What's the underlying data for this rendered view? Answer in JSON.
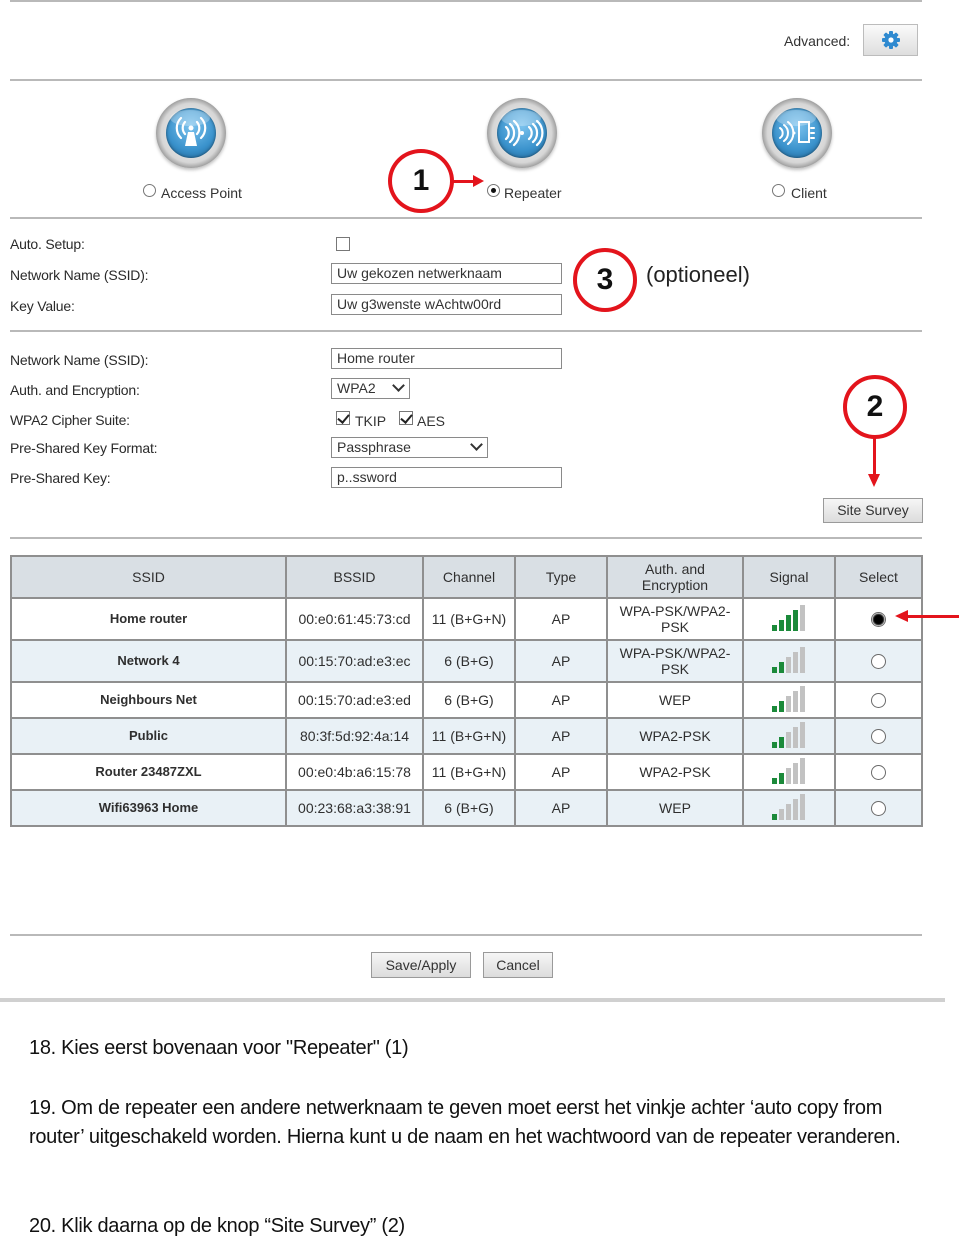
{
  "header": {
    "advanced_label": "Advanced:",
    "advanced_icon": "gear-icon",
    "accent_color": "#2f8ad0"
  },
  "modes": [
    {
      "label": "Access Point",
      "icon": "access-point-antenna-icon",
      "selected": false
    },
    {
      "label": "Repeater",
      "icon": "repeater-waves-icon",
      "selected": true
    },
    {
      "label": "Client",
      "icon": "client-device-icon",
      "selected": false
    }
  ],
  "annotations": {
    "callout_1": "1",
    "callout_2": "2",
    "callout_3": "3",
    "optional_note": "(optioneel)",
    "callout_color": "#e3141c"
  },
  "repeater_settings": {
    "auto_setup_label": "Auto. Setup:",
    "auto_setup_checked": false,
    "ssid_label": "Network Name (SSID):",
    "ssid_value": "Uw gekozen netwerknaam",
    "key_label": "Key Value:",
    "key_value": "Uw g3wenste wAchtw00rd"
  },
  "router_settings": {
    "ssid_label": "Network Name (SSID):",
    "ssid_value": "Home router",
    "auth_label": "Auth. and Encryption:",
    "auth_value": "WPA2",
    "cipher_label": "WPA2 Cipher Suite:",
    "cipher_tkip_label": "TKIP",
    "cipher_tkip_checked": true,
    "cipher_aes_label": "AES",
    "cipher_aes_checked": true,
    "psk_format_label": "Pre-Shared Key Format:",
    "psk_format_value": "Passphrase",
    "psk_label": "Pre-Shared Key:",
    "psk_value": "p..ssword",
    "site_survey_label": "Site Survey"
  },
  "survey_table": {
    "headers": [
      "SSID",
      "BSSID",
      "Channel",
      "Type",
      "Auth. and Encryption",
      "Signal",
      "Select"
    ],
    "signal_max_bars": 5,
    "rows": [
      {
        "ssid": "Home router",
        "bssid": "00:e0:61:45:73:cd",
        "channel": "11 (B+G+N)",
        "type": "AP",
        "auth": "WPA-PSK/WPA2-PSK",
        "signal_bars": 4,
        "selected": true
      },
      {
        "ssid": "Network 4",
        "bssid": "00:15:70:ad:e3:ec",
        "channel": "6 (B+G)",
        "type": "AP",
        "auth": "WPA-PSK/WPA2-PSK",
        "signal_bars": 2,
        "selected": false
      },
      {
        "ssid": "Neighbours Net",
        "bssid": "00:15:70:ad:e3:ed",
        "channel": "6 (B+G)",
        "type": "AP",
        "auth": "WEP",
        "signal_bars": 2,
        "selected": false
      },
      {
        "ssid": "Public",
        "bssid": "80:3f:5d:92:4a:14",
        "channel": "11 (B+G+N)",
        "type": "AP",
        "auth": "WPA2-PSK",
        "signal_bars": 2,
        "selected": false
      },
      {
        "ssid": "Router 23487ZXL",
        "bssid": "00:e0:4b:a6:15:78",
        "channel": "11 (B+G+N)",
        "type": "AP",
        "auth": "WPA2-PSK",
        "signal_bars": 2,
        "selected": false
      },
      {
        "ssid": "Wifi63963 Home",
        "bssid": "00:23:68:a3:38:91",
        "channel": "6 (B+G)",
        "type": "AP",
        "auth": "WEP",
        "signal_bars": 1,
        "selected": false
      }
    ]
  },
  "footer_buttons": {
    "save_label": "Save/Apply",
    "cancel_label": "Cancel"
  },
  "instructions": [
    "18. Kies eerst bovenaan voor \"Repeater\" (1)",
    "19. Om de repeater een andere netwerknaam te geven moet eerst het vinkje achter ‘auto copy from router’ uitgeschakeld worden. Hierna kunt u de naam en het wachtwoord van de repeater veranderen.",
    "20. Klik daarna op de knop “Site Survey” (2)"
  ]
}
